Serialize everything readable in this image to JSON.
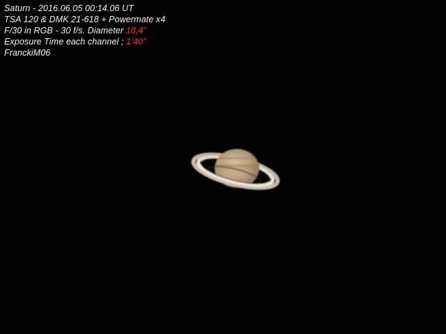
{
  "caption": {
    "line1": "Saturn - 2016.06.05  00:14.06 UT",
    "line2": "TSA 120 & DMK 21-618 + Powermate x4",
    "line3_prefix": "F/30 in RGB - 30 f/s. Diameter ",
    "line3_value": "18,4’’",
    "line4_prefix": "Exposure Time each channel ; ",
    "line4_value": "1’40’’",
    "line5": "FranckiM06"
  },
  "colors": {
    "background": "#020202",
    "caption_text": "#f2f2f2",
    "caption_highlight": "#ff2a2a",
    "planet_body": "#c9b08a",
    "rings": "#d8cfc2"
  }
}
